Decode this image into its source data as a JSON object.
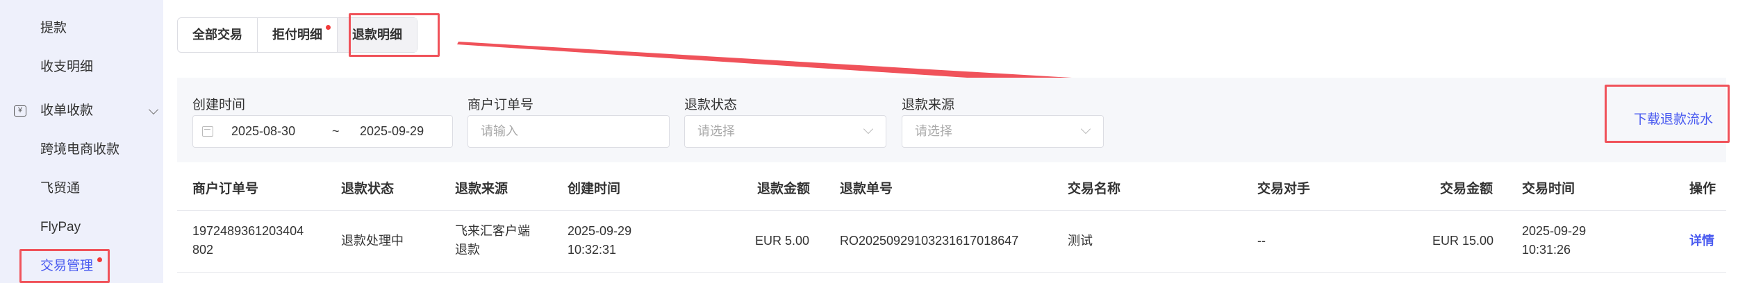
{
  "sidebar": {
    "items": [
      {
        "label": "提款"
      },
      {
        "label": "收支明细"
      },
      {
        "label": "收单收款",
        "icon": "yen-icon"
      },
      {
        "label": "跨境电商收款"
      },
      {
        "label": "飞贸通"
      },
      {
        "label": "FlyPay"
      },
      {
        "label": "交易管理",
        "active": true
      }
    ]
  },
  "tabs": [
    {
      "label": "全部交易"
    },
    {
      "label": "拒付明细",
      "badge": true
    },
    {
      "label": "退款明细",
      "active": true
    }
  ],
  "filters": {
    "created_time_label": "创建时间",
    "date_start": "2025-08-30",
    "date_sep": "~",
    "date_end": "2025-09-29",
    "order_no_label": "商户订单号",
    "order_no_placeholder": "请输入",
    "refund_status_label": "退款状态",
    "refund_status_placeholder": "请选择",
    "refund_source_label": "退款来源",
    "refund_source_placeholder": "请选择"
  },
  "download_label": "下载退款流水",
  "table": {
    "columns": [
      "商户订单号",
      "退款状态",
      "退款来源",
      "创建时间",
      "退款金额",
      "退款单号",
      "交易名称",
      "交易对手",
      "交易金额",
      "交易时间",
      "操作"
    ],
    "rows": [
      {
        "order_no_line1": "1972489361203404",
        "order_no_line2": "802",
        "status": "退款处理中",
        "source_line1": "飞来汇客户端",
        "source_line2": "退款",
        "created_date": "2025-09-29",
        "created_time": "10:32:31",
        "refund_amount": "EUR 5.00",
        "refund_no": "RO2025092910323161701​8647",
        "trade_name": "测试",
        "counterparty": "--",
        "trade_amount": "EUR 15.00",
        "trade_date": "2025-09-29",
        "trade_time": "10:31:26",
        "action": "详情"
      }
    ]
  },
  "colors": {
    "accent": "#4a5bf0",
    "highlight": "#f0525a",
    "sidebar_bg": "#eef0fb"
  }
}
